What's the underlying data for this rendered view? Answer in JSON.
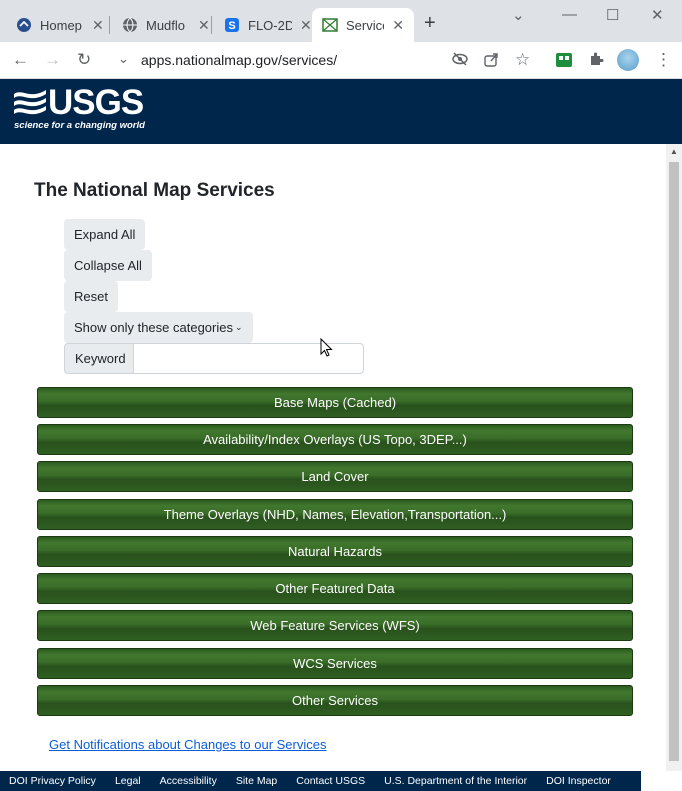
{
  "browser": {
    "tabs": [
      {
        "title": "Homep",
        "icon": "home-icon"
      },
      {
        "title": "Mudflo",
        "icon": "globe-icon"
      },
      {
        "title": "FLO-2D",
        "icon": "flo2d-icon"
      },
      {
        "title": "Service",
        "icon": "usgs-map-icon",
        "active": true
      }
    ],
    "new_tab": "+",
    "url": "apps.nationalmap.gov/services/"
  },
  "header": {
    "logo_text": "USGS",
    "logo_tagline": "science for a changing world"
  },
  "main": {
    "title": "The National Map Services",
    "expand_all": "Expand All",
    "collapse_all": "Collapse All",
    "reset": "Reset",
    "show_only": "Show only these categories",
    "keyword_label": "Keyword",
    "keyword_value": "",
    "categories": [
      "Base Maps (Cached)",
      "Availability/Index Overlays (US Topo, 3DEP...)",
      "Land Cover",
      "Theme Overlays (NHD, Names, Elevation,Transportation...)",
      "Natural Hazards",
      "Other Featured Data",
      "Web Feature Services (WFS)",
      "WCS Services",
      "Other Services"
    ],
    "notify_link": "Get Notifications about Changes to our Services"
  },
  "footer": {
    "links": [
      "DOI Privacy Policy",
      "Legal",
      "Accessibility",
      "Site Map",
      "Contact USGS",
      "U.S. Department of the Interior",
      "DOI Inspector"
    ]
  },
  "colors": {
    "header_bg": "#00264c",
    "category_green": "#3a6d29",
    "link_blue": "#0b5ed7"
  }
}
